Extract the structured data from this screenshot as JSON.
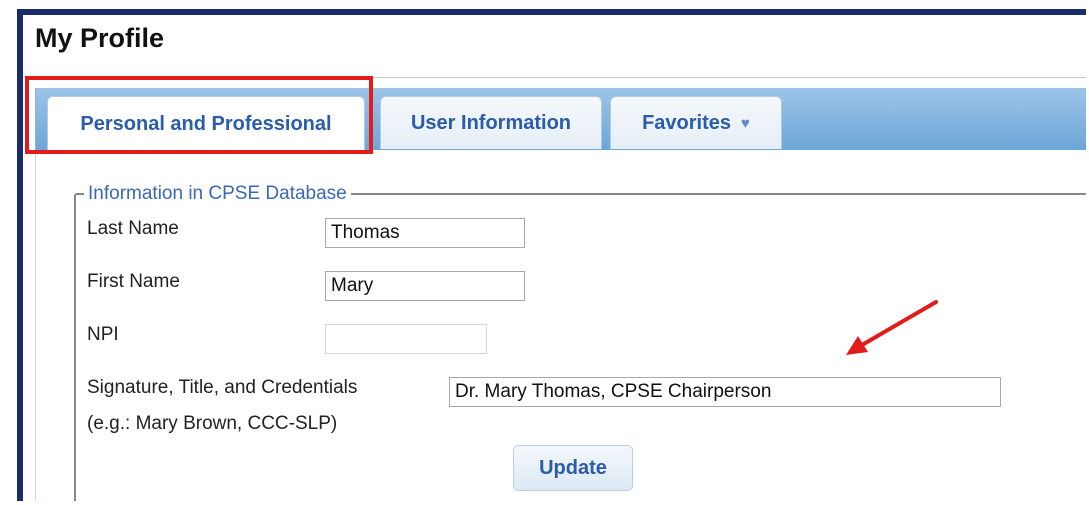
{
  "page": {
    "title": "My Profile"
  },
  "tabs": [
    {
      "label": "Personal and Professional",
      "active": true
    },
    {
      "label": "User Information",
      "active": false
    },
    {
      "label": "Favorites",
      "icon": "heart-icon",
      "active": false
    }
  ],
  "fieldset": {
    "legend": "Information in CPSE Database"
  },
  "fields": {
    "last_name": {
      "label": "Last Name",
      "value": "Thomas"
    },
    "first_name": {
      "label": "First Name",
      "value": "Mary"
    },
    "npi": {
      "label": "NPI",
      "value": ""
    },
    "signature": {
      "label": "Signature, Title, and Credentials",
      "hint": "(e.g.: Mary Brown, CCC-SLP)",
      "value": "Dr. Mary Thomas, CPSE Chairperson"
    }
  },
  "buttons": {
    "update": "Update"
  },
  "colors": {
    "highlight": "#e21b1b",
    "tab_text": "#2a5caa",
    "frame": "#1a2d6b",
    "arrow": "#e21b1b"
  }
}
